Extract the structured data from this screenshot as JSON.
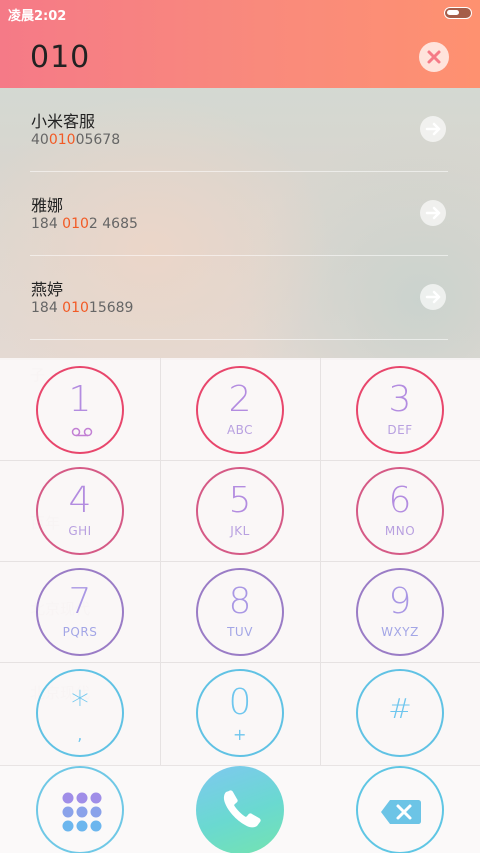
{
  "status_bar": {
    "time": "凌晨2:02"
  },
  "dialer": {
    "number": "010"
  },
  "results": [
    {
      "name": "小米客服",
      "number_pre": "40",
      "number_hl": "010",
      "number_post": "05678"
    },
    {
      "name": "雅娜",
      "number_pre": "184 ",
      "number_hl": "010",
      "number_post": "2 4685"
    },
    {
      "name": "燕婷",
      "number_pre": "184 ",
      "number_hl": "010",
      "number_post": "15689"
    }
  ],
  "keys": [
    {
      "digit": "1",
      "letters": ""
    },
    {
      "digit": "2",
      "letters": "ABC"
    },
    {
      "digit": "3",
      "letters": "DEF"
    },
    {
      "digit": "4",
      "letters": "GHI"
    },
    {
      "digit": "5",
      "letters": "JKL"
    },
    {
      "digit": "6",
      "letters": "MNO"
    },
    {
      "digit": "7",
      "letters": "PQRS"
    },
    {
      "digit": "8",
      "letters": "TUV"
    },
    {
      "digit": "9",
      "letters": "WXYZ"
    },
    {
      "digit": "*",
      "letters": ","
    },
    {
      "digit": "0",
      "letters": "+"
    },
    {
      "digit": "#",
      "letters": ""
    }
  ],
  "icons": {
    "clear": "close-icon",
    "call_contact": "arrow-right-icon",
    "voicemail": "voicemail-icon",
    "dialpad": "dialpad-icon",
    "call": "phone-icon",
    "backspace": "backspace-icon"
  },
  "colors": {
    "header_start": "#f57a87",
    "header_end": "#fe9170",
    "highlight": "#f25a25",
    "key_ring_top": "#e84a6f",
    "key_ring_bottom": "#5fc6e4",
    "call_button": "#6ad9d0"
  }
}
